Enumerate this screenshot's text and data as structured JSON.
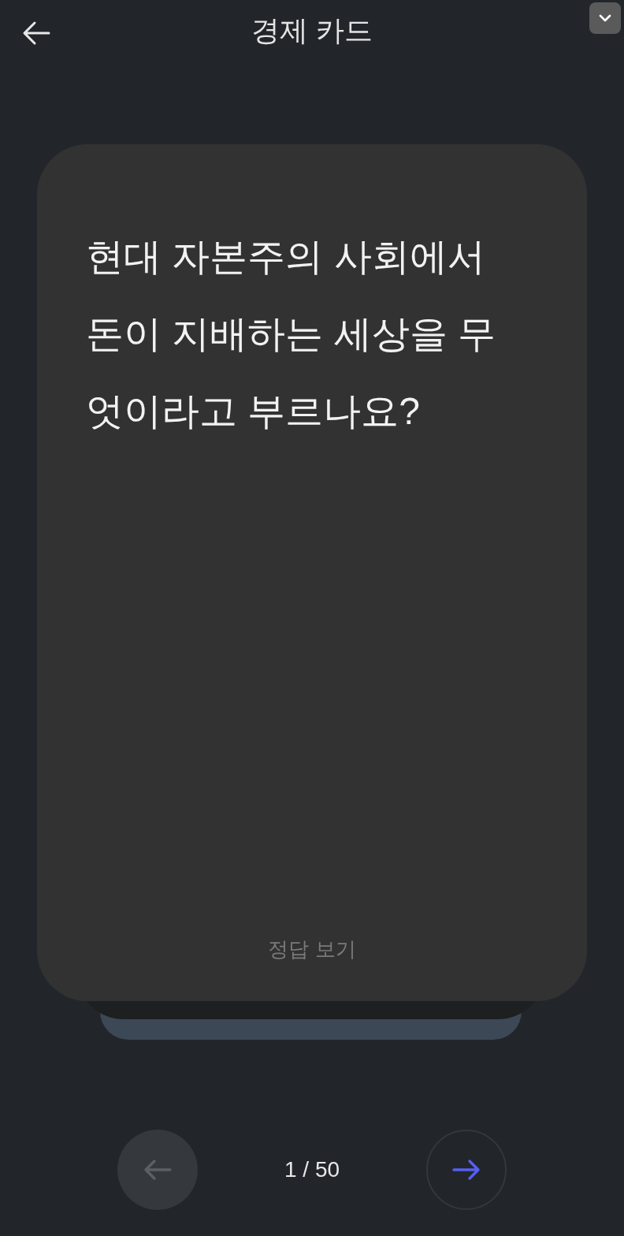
{
  "header": {
    "title": "경제 카드"
  },
  "card": {
    "question": "현대 자본주의 사회에서 돈이 지배하는 세상을 무엇이라고 부르나요?",
    "reveal_label": "정답 보기"
  },
  "navigation": {
    "prev": {
      "disabled": true
    },
    "counter": "1 / 50",
    "next": {
      "disabled": false
    }
  }
}
